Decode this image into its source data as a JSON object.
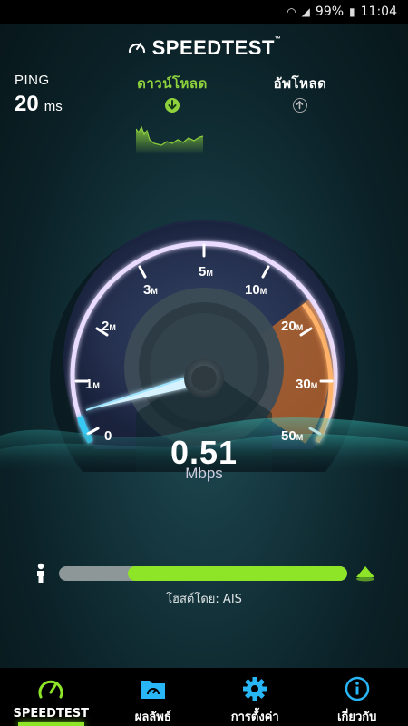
{
  "status_bar": {
    "battery": "99%",
    "time": "11:04"
  },
  "header": {
    "title": "SPEEDTEST",
    "trademark": "™"
  },
  "ping": {
    "label": "PING",
    "value": "20",
    "unit": "ms"
  },
  "download": {
    "label": "ดาวน์โหลด",
    "icon": "arrow-down-circle-icon"
  },
  "upload": {
    "label": "อัพโหลด",
    "icon": "arrow-up-circle-icon"
  },
  "gauge": {
    "ticks": [
      "0",
      "1",
      "2",
      "3",
      "5",
      "10",
      "20",
      "30",
      "50"
    ],
    "tick_suffix": "M",
    "needle_value_mbps": 0.51
  },
  "result": {
    "value": "0.51",
    "unit": "Mbps"
  },
  "progress": {
    "fraction": 0.76
  },
  "host": {
    "text": "โฮสต์โดย: AIS"
  },
  "nav": [
    {
      "label": "SPEEDTEST",
      "icon": "speedometer-icon",
      "active": true
    },
    {
      "label": "ผลลัพธ์",
      "icon": "folder-icon",
      "active": false
    },
    {
      "label": "การตั้งค่า",
      "icon": "gear-icon",
      "active": false
    },
    {
      "label": "เกี่ยวกับ",
      "icon": "info-icon",
      "active": false
    }
  ],
  "colors": {
    "accent_green": "#8ee528",
    "nav_icon_cyan": "#29b6f6",
    "gauge_purple": "#b48cff",
    "gauge_orange": "#e87a2a"
  }
}
